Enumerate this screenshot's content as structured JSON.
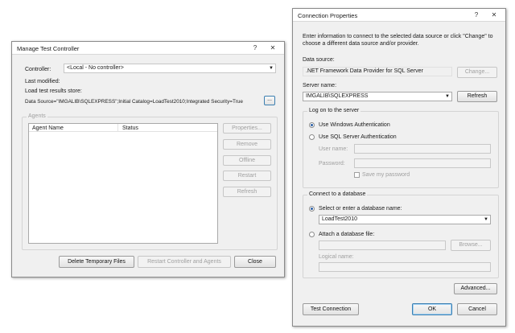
{
  "manage": {
    "title": "Manage Test Controller",
    "help": "?",
    "close": "✕",
    "controller_label": "Controller:",
    "controller_value": "<Local - No controller>",
    "last_modified_label": "Last modified:",
    "results_store_label": "Load test results store:",
    "connection_string": "Data Source=\"IMGALIB\\SQLEXPRESS\";Initial Catalog=LoadTest2010;Integrated Security=True",
    "browse_label": "...",
    "agents_label": "Agents",
    "columns": [
      "Agent Name",
      "Status"
    ],
    "side_buttons": [
      "Properties...",
      "Remove",
      "Offline",
      "Restart",
      "Refresh"
    ],
    "delete_temp_files": "Delete Temporary Files",
    "restart_controller": "Restart Controller and Agents",
    "close_button": "Close"
  },
  "connection": {
    "title": "Connection Properties",
    "help": "?",
    "close": "✕",
    "intro": "Enter information to connect to the selected data source or click \"Change\" to choose a different data source and/or provider.",
    "data_source_label": "Data source:",
    "data_source_value": ".NET Framework Data Provider for SQL Server",
    "change_button": "Change...",
    "server_name_label": "Server name:",
    "server_name_value": "IMGALIB\\SQLEXPRESS",
    "refresh_button": "Refresh",
    "logon_group": "Log on to the server",
    "windows_auth": "Use Windows Authentication",
    "sql_auth": "Use SQL Server Authentication",
    "user_name_label": "User name:",
    "password_label": "Password:",
    "save_password": "Save my password",
    "connect_db_group": "Connect to a database",
    "select_db_label": "Select or enter a database name:",
    "db_value": "LoadTest2010",
    "attach_db_label": "Attach a database file:",
    "browse_button": "Browse...",
    "logical_name_label": "Logical name:",
    "advanced_button": "Advanced...",
    "test_connection_button": "Test Connection",
    "ok_button": "OK",
    "cancel_button": "Cancel"
  }
}
